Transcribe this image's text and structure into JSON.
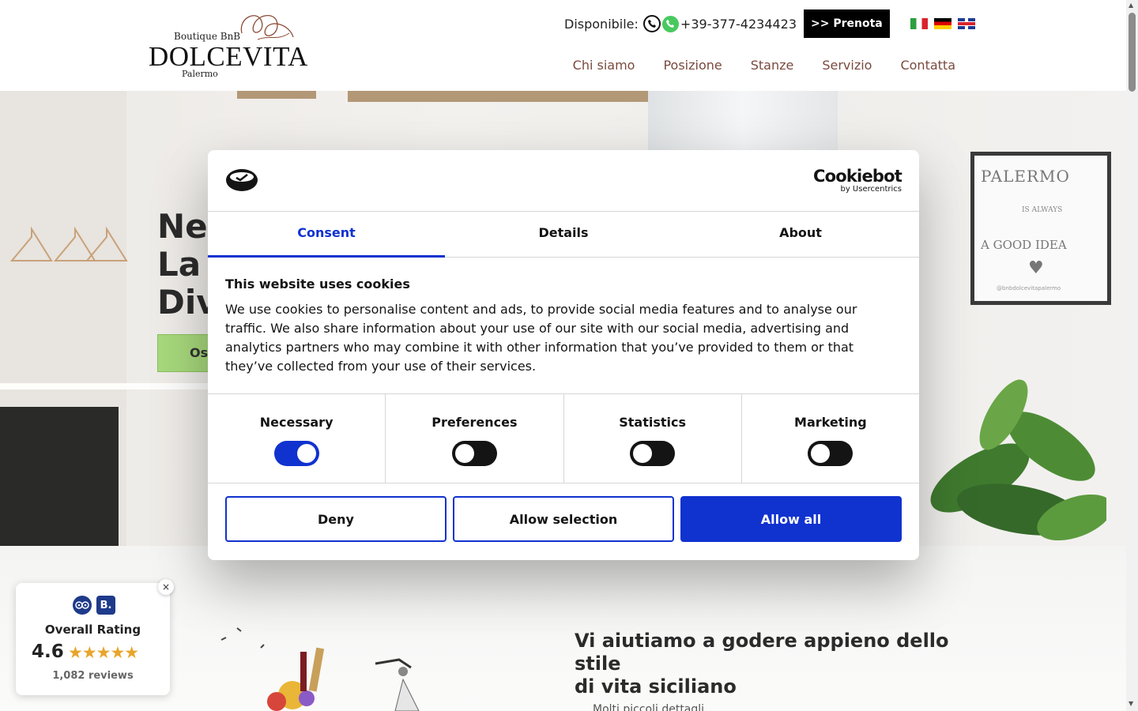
{
  "header": {
    "logo": {
      "subtitle": "Boutique BnB",
      "name": "DOLCEVITA",
      "city": "Palermo"
    },
    "availability_label": "Disponibile:",
    "phone": "+39-377-4234423",
    "book_label": ">> Prenota",
    "languages": [
      "it",
      "de",
      "en"
    ],
    "nav": [
      "Chi siamo",
      "Posizione",
      "Stanze",
      "Servizio",
      "Contatta"
    ]
  },
  "hero": {
    "headline_lines": [
      "Nel",
      "La",
      "Div"
    ],
    "cta_label": "Os",
    "poster": {
      "title": "PALERMO",
      "subtitle": "IS ALWAYS",
      "tagline": "A GOOD IDEA",
      "handle": "@bnbdolcevitapalermo"
    }
  },
  "lower": {
    "heading_line1": "Vi aiutiamo a godere appieno dello stile",
    "heading_line2": "di vita siciliano",
    "sub_text": "Molti piccoli dettagli..."
  },
  "rating": {
    "title": "Overall Rating",
    "score": "4.6",
    "stars": "★★★★★",
    "count": "1,082 reviews",
    "close": "×",
    "booking_letter": "B."
  },
  "cookie": {
    "brand_name": "Cookiebot",
    "brand_by": "by Usercentrics",
    "tabs": [
      "Consent",
      "Details",
      "About"
    ],
    "active_tab": 0,
    "title": "This website uses cookies",
    "text": "We use cookies to personalise content and ads, to provide social media features and to analyse our traffic. We also share information about your use of our site with our social media, advertising and analytics partners who may combine it with other information that you’ve provided to them or that they’ve collected from your use of their services.",
    "categories": [
      {
        "label": "Necessary",
        "on": true
      },
      {
        "label": "Preferences",
        "on": false
      },
      {
        "label": "Statistics",
        "on": false
      },
      {
        "label": "Marketing",
        "on": false
      }
    ],
    "buttons": {
      "deny": "Deny",
      "allow_selection": "Allow selection",
      "allow_all": "Allow all"
    }
  },
  "colors": {
    "accent": "#1032cf",
    "nav_text": "#7a4a3e",
    "cta_green": "#a7d97c",
    "star": "#e8a52b"
  }
}
